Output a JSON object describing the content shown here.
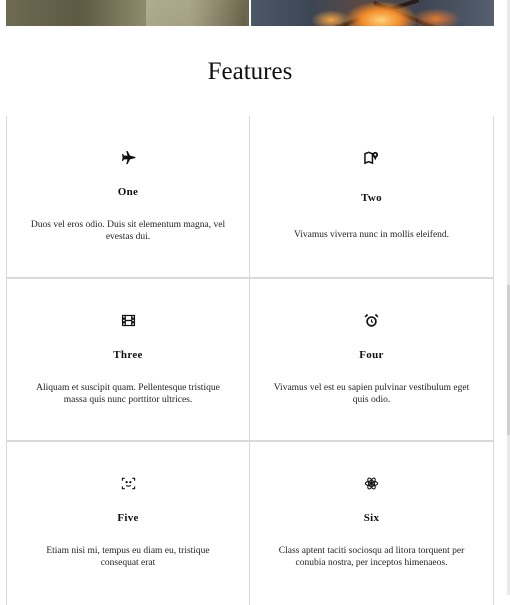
{
  "section": {
    "title": "Features"
  },
  "features": [
    {
      "name": "One",
      "icon": "airplane-icon",
      "description": "Duos vel eros odio. Duis sit elementum magna, vel evestas dui."
    },
    {
      "name": "Two",
      "icon": "map-pin-icon",
      "description": "Vivamus viverra nunc in mollis eleifend."
    },
    {
      "name": "Three",
      "icon": "film-icon",
      "description": "Aliquam et suscipit quam. Pellentesque tristique massa quis nunc porttitor ultrices."
    },
    {
      "name": "Four",
      "icon": "alarm-clock-icon",
      "description": "Vivamus vel est eu sapien pulvinar vestibulum eget quis odio."
    },
    {
      "name": "Five",
      "icon": "face-scan-icon",
      "description": "Etiam nisi mi, tempus eu diam eu, tristique consequat erat"
    },
    {
      "name": "Six",
      "icon": "atom-icon",
      "description": "Class aptent taciti sociosqu ad litora torquent per conubia nostra, per inceptos himenaeos."
    }
  ]
}
